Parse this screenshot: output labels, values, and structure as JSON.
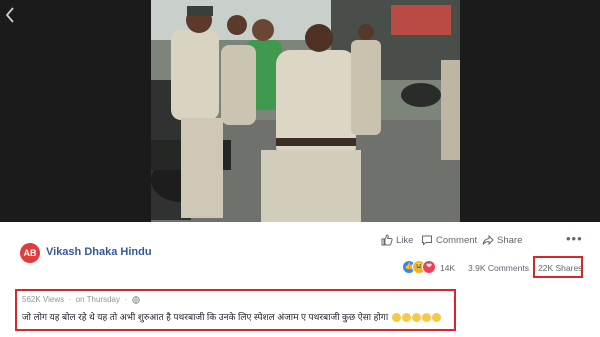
{
  "video": {
    "description_icon": "back-chevron-icon"
  },
  "post": {
    "page_name": "Vikash Dhaka Hindu",
    "avatar_text": "AB",
    "actions": {
      "like": "Like",
      "comment": "Comment",
      "share": "Share",
      "more": "•••"
    },
    "stats": {
      "reactions_count": "14K",
      "comments": "3.9K Comments",
      "shares": "22K Shares"
    },
    "views": "562K Views",
    "time": "on Thursday",
    "text": "जो लोग यह बोल रहे थे यह तो अभी शुरुआत है पथरबाजी कि उनके लिए स्पेशल अंजाम ए पथरबाजी कुछ ऐसा होगा"
  },
  "colors": {
    "highlight": "#d8262d",
    "link": "#365899"
  }
}
